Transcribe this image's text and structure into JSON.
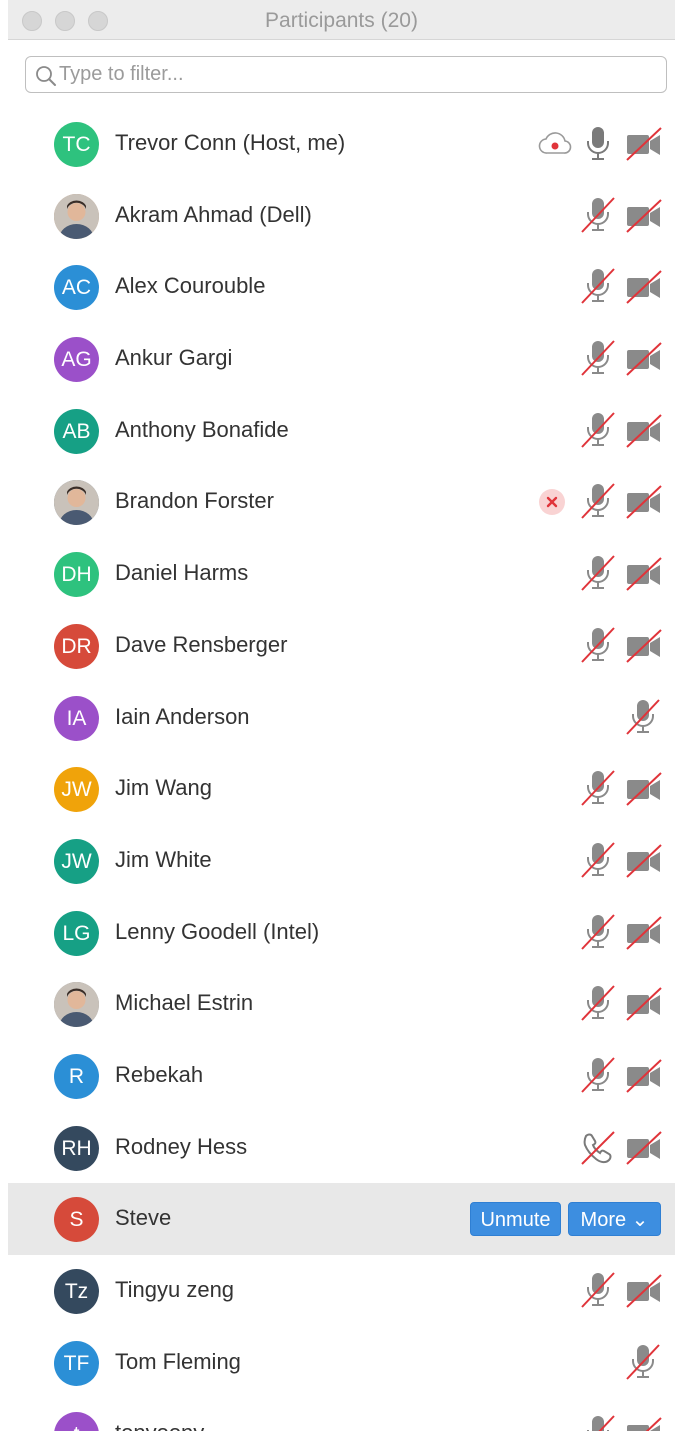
{
  "window": {
    "title": "Participants (20)"
  },
  "search": {
    "placeholder": "Type to filter...",
    "value": ""
  },
  "colors": {
    "accent": "#3d8ee0",
    "muted_red": "#e0343a",
    "icon_gray": "#7a7a7a"
  },
  "buttons": {
    "unmute": "Unmute",
    "more": "More"
  },
  "participants": [
    {
      "name": "Trevor Conn (Host, me)",
      "initials": "TC",
      "color": "#2ec27e",
      "photo": false,
      "extra": "cloud-record-icon",
      "audio": "mic-on",
      "video": "video-off"
    },
    {
      "name": "Akram Ahmad (Dell)",
      "initials": "",
      "color": "#b88b6a",
      "photo": true,
      "extra": null,
      "audio": "mic-muted",
      "video": "video-off"
    },
    {
      "name": "Alex Courouble",
      "initials": "AC",
      "color": "#2b8fd6",
      "photo": false,
      "extra": null,
      "audio": "mic-muted",
      "video": "video-off"
    },
    {
      "name": "Ankur Gargi",
      "initials": "AG",
      "color": "#9b50c9",
      "photo": false,
      "extra": null,
      "audio": "mic-muted",
      "video": "video-off"
    },
    {
      "name": "Anthony Bonafide",
      "initials": "AB",
      "color": "#16a085",
      "photo": false,
      "extra": null,
      "audio": "mic-muted",
      "video": "video-off"
    },
    {
      "name": "Brandon Forster",
      "initials": "",
      "color": "#5a6a7a",
      "photo": true,
      "extra": "remove-icon",
      "audio": "mic-muted",
      "video": "video-off"
    },
    {
      "name": "Daniel Harms",
      "initials": "DH",
      "color": "#2ec27e",
      "photo": false,
      "extra": null,
      "audio": "mic-muted",
      "video": "video-off"
    },
    {
      "name": "Dave Rensberger",
      "initials": "DR",
      "color": "#d64a3a",
      "photo": false,
      "extra": null,
      "audio": "mic-muted",
      "video": "video-off"
    },
    {
      "name": "Iain Anderson",
      "initials": "IA",
      "color": "#9b50c9",
      "photo": false,
      "extra": null,
      "audio": "mic-muted",
      "video": null
    },
    {
      "name": "Jim Wang",
      "initials": "JW",
      "color": "#f0a30a",
      "photo": false,
      "extra": null,
      "audio": "mic-muted",
      "video": "video-off"
    },
    {
      "name": "Jim White",
      "initials": "JW",
      "color": "#16a085",
      "photo": false,
      "extra": null,
      "audio": "mic-muted",
      "video": "video-off"
    },
    {
      "name": "Lenny Goodell (Intel)",
      "initials": "LG",
      "color": "#16a085",
      "photo": false,
      "extra": null,
      "audio": "mic-muted",
      "video": "video-off"
    },
    {
      "name": "Michael Estrin",
      "initials": "",
      "color": "#8a8a8a",
      "photo": true,
      "extra": null,
      "audio": "mic-muted",
      "video": "video-off"
    },
    {
      "name": "Rebekah",
      "initials": "R",
      "color": "#2b8fd6",
      "photo": false,
      "extra": null,
      "audio": "mic-muted",
      "video": "video-off"
    },
    {
      "name": "Rodney Hess",
      "initials": "RH",
      "color": "#34495e",
      "photo": false,
      "extra": null,
      "audio": "phone-muted",
      "video": "video-off"
    },
    {
      "name": "Steve",
      "initials": "S",
      "color": "#d64a3a",
      "photo": false,
      "extra": null,
      "audio": null,
      "video": null,
      "selected": true
    },
    {
      "name": "Tingyu zeng",
      "initials": "Tz",
      "color": "#34495e",
      "photo": false,
      "extra": null,
      "audio": "mic-muted",
      "video": "video-off"
    },
    {
      "name": "Tom Fleming",
      "initials": "TF",
      "color": "#2b8fd6",
      "photo": false,
      "extra": null,
      "audio": "mic-muted",
      "video": null
    },
    {
      "name": "tonyoony",
      "initials": "t",
      "color": "#9b50c9",
      "photo": false,
      "extra": null,
      "audio": "mic-muted",
      "video": "video-off"
    }
  ]
}
